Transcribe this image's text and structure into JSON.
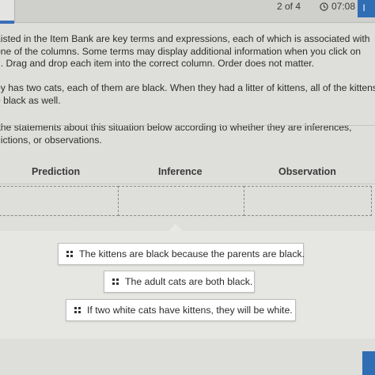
{
  "topbar": {
    "page_counter": "2 of 4",
    "timer": "07:08",
    "info_label": "I"
  },
  "instructions": {
    "paragraph1_lines": [
      "Listed in the Item Bank are key terms and expressions, each of which is associated with",
      "one of the columns. Some terms may display additional information when you click on",
      "n. Drag and drop each item into the correct column. Order does not matter."
    ],
    "paragraph2_lines": [
      "ey has two cats, each of them are black. When they had a litter of kittens, all of the kittens",
      "e black as well."
    ],
    "paragraph3_lines": [
      " the statements about this situation below according to whether they are inferences,",
      "dictions, or observations."
    ]
  },
  "columns": {
    "prediction": "Prediction",
    "inference": "Inference",
    "observation": "Observation"
  },
  "item_bank": [
    {
      "text": "The kittens are black because the parents are black."
    },
    {
      "text": "The adult cats are both black."
    },
    {
      "text": "If two white cats have kittens, they will be white."
    }
  ],
  "icons": {
    "clock": "clock-icon",
    "grip": "drag-handle-icon"
  },
  "colors": {
    "accent": "#2f6db5",
    "background": "#dededb"
  }
}
